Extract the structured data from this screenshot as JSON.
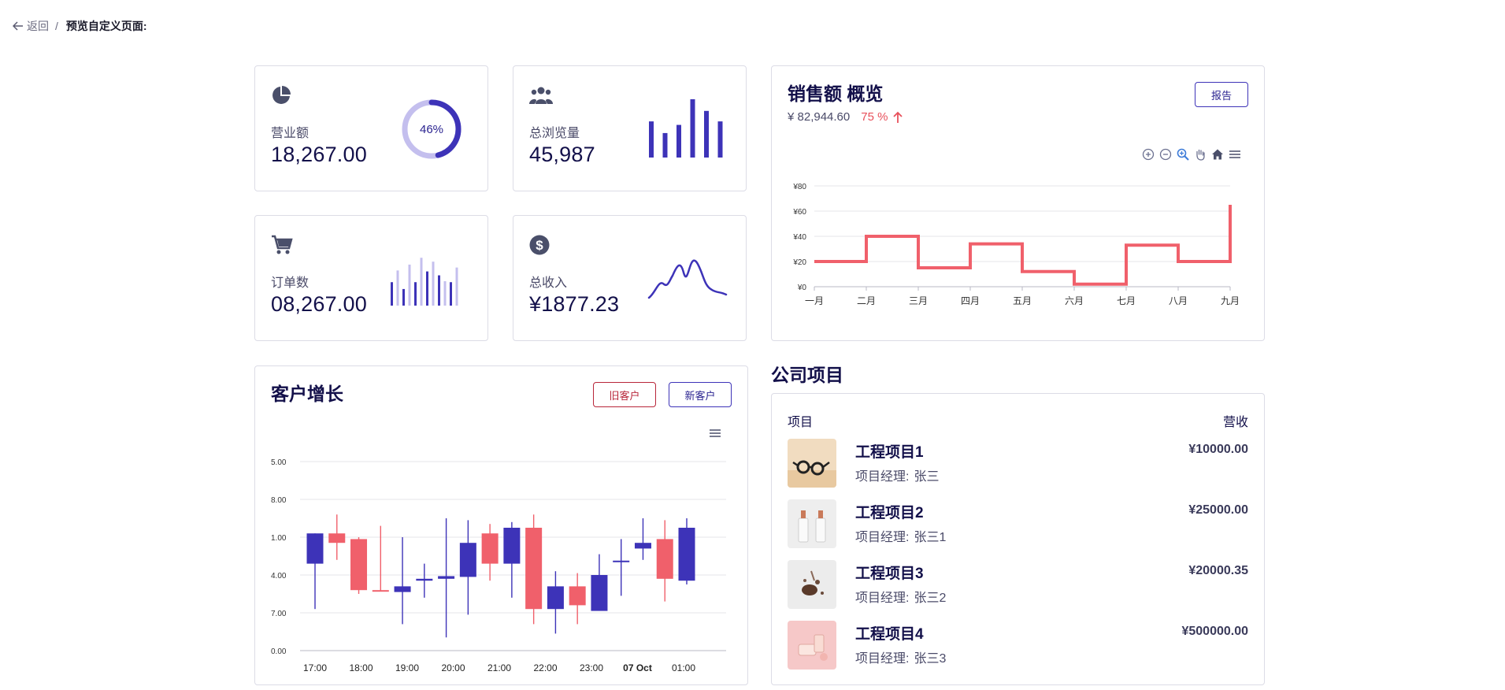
{
  "breadcrumb": {
    "back_label": "返回",
    "separator": "/",
    "title": "预览自定义页面:"
  },
  "colors": {
    "primary": "#3d33b8",
    "primary_light": "#c4bfee",
    "accent_red": "#e8505b",
    "text_dark": "#13104a"
  },
  "kpis": [
    {
      "icon": "pie-chart-icon",
      "label": "营业额",
      "value": "18,267.00",
      "gauge_text": "46%",
      "gauge_percent": 46
    },
    {
      "icon": "users-icon",
      "label": "总浏览量",
      "value": "45,987",
      "bars": [
        0.62,
        0.42,
        0.56,
        1.0,
        0.8,
        0.62
      ]
    },
    {
      "icon": "cart-icon",
      "label": "订单数",
      "value": "08,267.00",
      "bars": [
        0.48,
        0.72,
        0.34,
        0.84,
        0.48,
        0.98,
        0.7,
        0.9,
        0.62,
        0.5,
        0.48,
        0.78
      ]
    },
    {
      "icon": "dollar-icon",
      "label": "总收入",
      "value": "¥1877.23"
    }
  ],
  "sales": {
    "title": "销售额 概览",
    "amount": "¥ 82,944.60",
    "change": "75 %",
    "report_button": "报告",
    "toolbar": [
      "zoom-in-icon",
      "zoom-out-icon",
      "magnify-icon",
      "pan-hand-icon",
      "home-icon",
      "menu-icon"
    ]
  },
  "customer_growth": {
    "title": "客户增长",
    "old_button": "旧客户",
    "new_button": "新客户",
    "menu_icon": "menu-icon"
  },
  "projects": {
    "heading": "公司项目",
    "col_item": "项目",
    "col_revenue": "营收",
    "manager_label": "项目经理:",
    "items": [
      {
        "name": "工程项目1",
        "manager": "张三",
        "revenue": "¥10000.00",
        "thumb": "glasses-image"
      },
      {
        "name": "工程项目2",
        "manager": "张三1",
        "revenue": "¥25000.00",
        "thumb": "bottles-image"
      },
      {
        "name": "工程项目3",
        "manager": "张三2",
        "revenue": "¥20000.35",
        "thumb": "spices-image"
      },
      {
        "name": "工程项目4",
        "manager": "张三3",
        "revenue": "¥500000.00",
        "thumb": "cosmetics-image"
      }
    ]
  },
  "chart_data": [
    {
      "type": "line",
      "step": true,
      "categories": [
        "一月",
        "二月",
        "三月",
        "四月",
        "五月",
        "六月",
        "七月",
        "八月",
        "九月"
      ],
      "series": [
        {
          "values": [
            20,
            40,
            15,
            34,
            12,
            2,
            33,
            20,
            65
          ],
          "color": "#f0606b"
        }
      ],
      "y_ticks": [
        "¥0",
        "¥20",
        "¥40",
        "¥60",
        "¥80"
      ],
      "ylim": [
        0,
        80
      ],
      "grid": true
    },
    {
      "type": "candlestick",
      "x_ticks": [
        "17:00",
        "18:00",
        "19:00",
        "20:00",
        "21:00",
        "22:00",
        "23:00",
        "07 Oct",
        "01:00"
      ],
      "y_ticks": [
        "5.00",
        "8.00",
        "1.00",
        "4.00",
        "7.00",
        "0.00"
      ],
      "ylim": [
        0,
        5
      ],
      "grid": true,
      "up_color": "#3d33b8",
      "down_color": "#f0606b",
      "candles": [
        {
          "open": 2.3,
          "close": 3.1,
          "high": 3.1,
          "low": 1.1,
          "dir": "up"
        },
        {
          "open": 3.1,
          "close": 2.85,
          "high": 3.6,
          "low": 2.4,
          "dir": "down"
        },
        {
          "open": 2.95,
          "close": 1.6,
          "high": 3.0,
          "low": 1.5,
          "dir": "down"
        },
        {
          "open": 1.6,
          "close": 1.58,
          "high": 3.3,
          "low": 1.58,
          "dir": "down"
        },
        {
          "open": 1.55,
          "close": 1.7,
          "high": 3.0,
          "low": 0.7,
          "dir": "up"
        },
        {
          "open": 1.85,
          "close": 1.9,
          "high": 2.3,
          "low": 1.4,
          "dir": "up"
        },
        {
          "open": 1.9,
          "close": 1.97,
          "high": 3.5,
          "low": 0.35,
          "dir": "up"
        },
        {
          "open": 1.95,
          "close": 2.85,
          "high": 3.45,
          "low": 0.95,
          "dir": "up"
        },
        {
          "open": 3.1,
          "close": 2.3,
          "high": 3.35,
          "low": 1.85,
          "dir": "down"
        },
        {
          "open": 2.3,
          "close": 3.25,
          "high": 3.4,
          "low": 1.4,
          "dir": "up"
        },
        {
          "open": 3.25,
          "close": 1.1,
          "high": 3.6,
          "low": 0.7,
          "dir": "down"
        },
        {
          "open": 1.1,
          "close": 1.7,
          "high": 2.1,
          "low": 0.45,
          "dir": "up"
        },
        {
          "open": 1.7,
          "close": 1.2,
          "high": 2.05,
          "low": 0.7,
          "dir": "down"
        },
        {
          "open": 1.05,
          "close": 2.0,
          "high": 2.55,
          "low": 1.4,
          "dir": "up"
        },
        {
          "open": 2.35,
          "close": 2.38,
          "high": 2.95,
          "low": 1.45,
          "dir": "up"
        },
        {
          "open": 2.7,
          "close": 2.85,
          "high": 3.5,
          "low": 2.4,
          "dir": "up"
        },
        {
          "open": 2.95,
          "close": 1.9,
          "high": 3.45,
          "low": 1.3,
          "dir": "down"
        },
        {
          "open": 1.85,
          "close": 3.25,
          "high": 3.5,
          "low": 1.75,
          "dir": "up"
        }
      ]
    }
  ]
}
